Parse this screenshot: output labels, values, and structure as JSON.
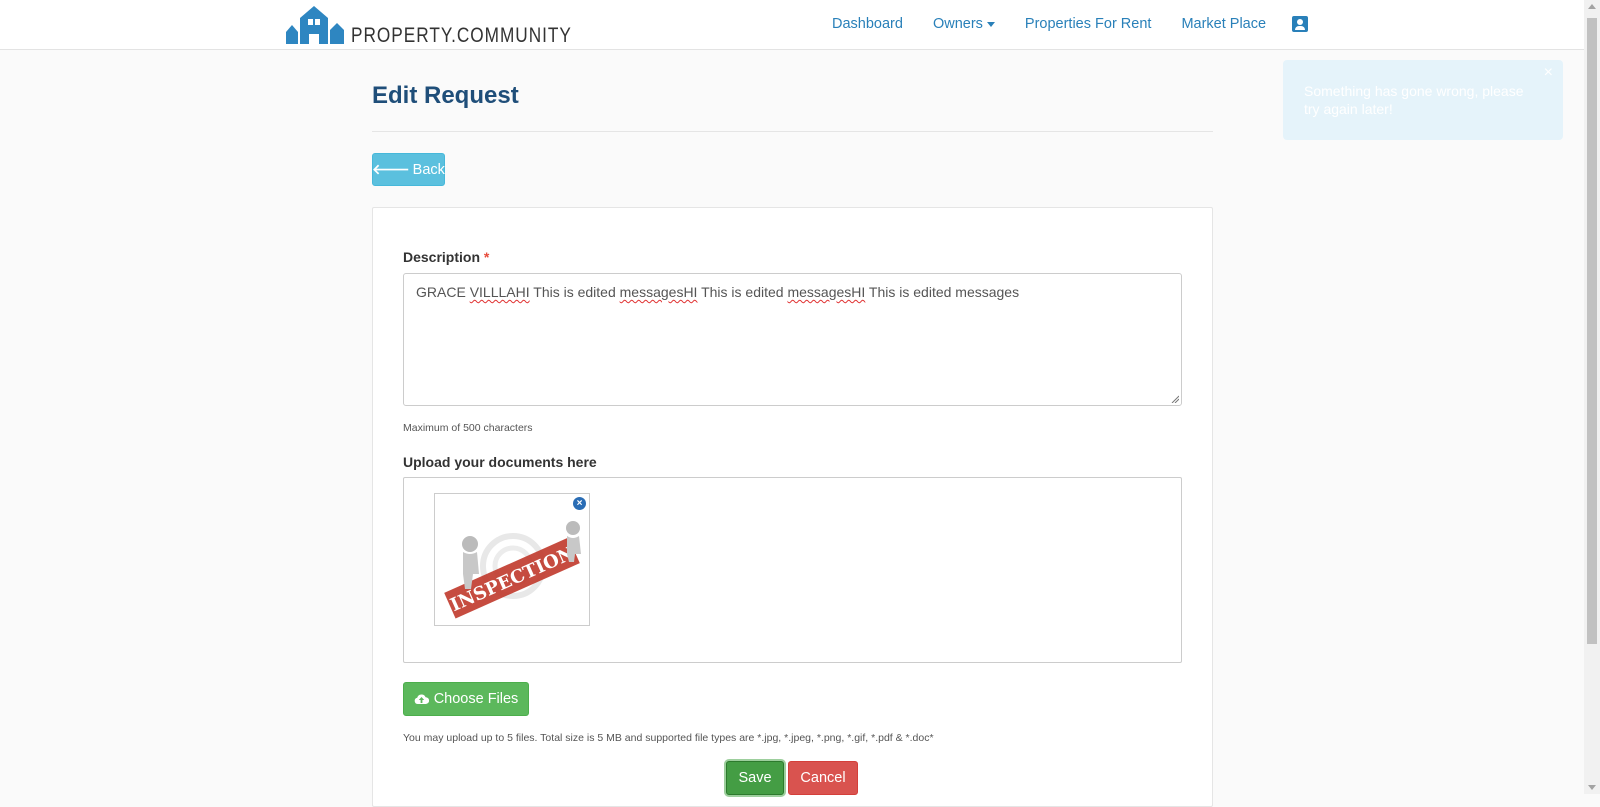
{
  "header": {
    "logo_text": "PROPERTY.COMMUNITY",
    "nav": {
      "dashboard": "Dashboard",
      "owners": "Owners",
      "properties_for_rent": "Properties For Rent",
      "market_place": "Market Place"
    },
    "icons": {
      "profile": "profile-card-icon",
      "owners_dropdown": "caret-down-icon"
    }
  },
  "toast": {
    "message": "Something has gone wrong, please try again later!",
    "close": "×"
  },
  "page": {
    "title": "Edit Request",
    "back_label": "Back"
  },
  "form": {
    "description_label": "Description",
    "required_marker": "*",
    "description_parts": [
      "GRACE ",
      "VILLLAHI",
      " This is edited ",
      "messagesHI",
      " This is edited ",
      "messagesHI",
      " This is edited messages"
    ],
    "description_help": "Maximum of 500 characters",
    "upload_label": "Upload your documents here",
    "uploaded_file": {
      "image_text": "INSPECTION",
      "remove_icon": "×"
    },
    "choose_files_label": "Choose Files",
    "upload_help": "You may upload up to 5 files. Total size is 5 MB and supported file types are *.jpg, *.jpeg, *.png, *.gif, *.pdf & *.doc*",
    "save_label": "Save",
    "cancel_label": "Cancel"
  },
  "colors": {
    "link": "#2980b9",
    "title": "#1f4e79",
    "info": "#5bc0de",
    "success": "#5cb85c",
    "danger": "#d9534f"
  }
}
